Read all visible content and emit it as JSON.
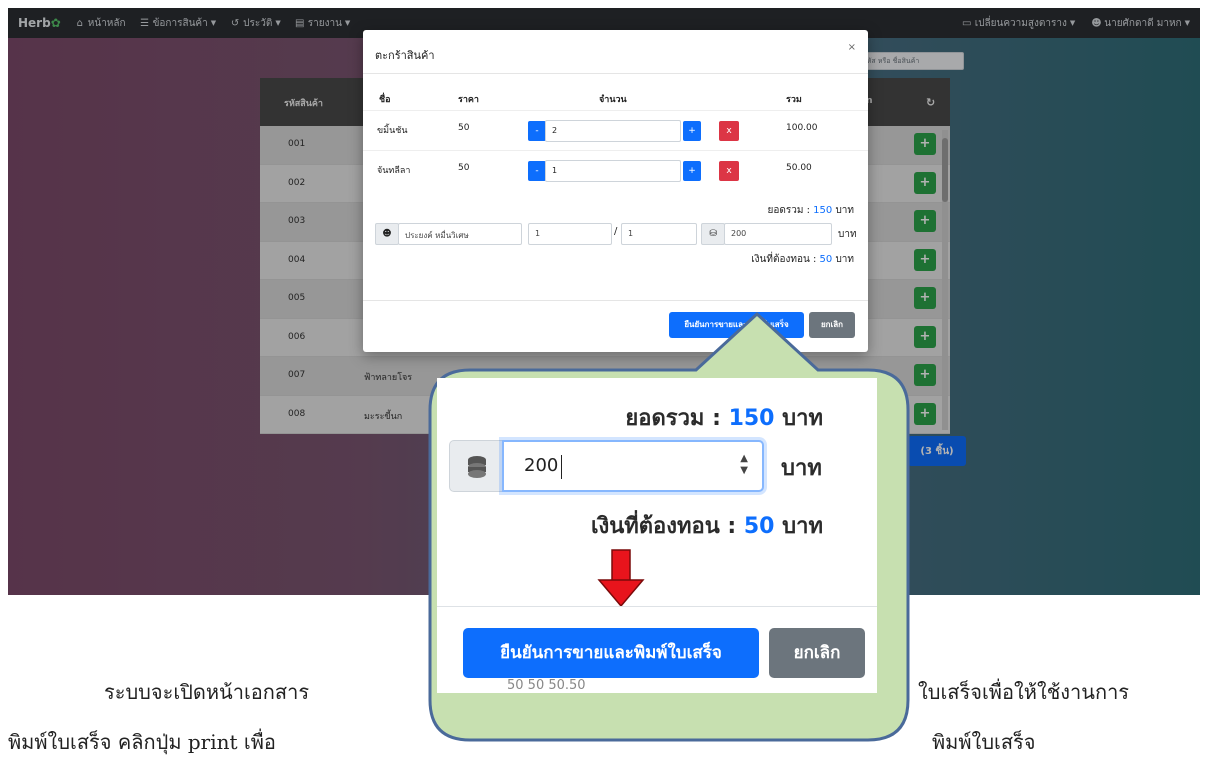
{
  "navbar": {
    "brand": "Herb",
    "items": [
      {
        "label": "หน้าหลัก",
        "icon": "home-icon"
      },
      {
        "label": "ข้อการสินค้า",
        "icon": "list-icon"
      },
      {
        "label": "ประวัติ",
        "icon": "history-icon"
      },
      {
        "label": "รายงาน",
        "icon": "report-icon"
      }
    ],
    "right": [
      {
        "label": "เปลี่ยนความสูงตาราง",
        "icon": "table-icon"
      },
      {
        "label": "นายศักดาดี มาหก",
        "icon": "user-icon"
      }
    ]
  },
  "search": {
    "placeholder": "รหัส หรือ ชื่อสินค้า"
  },
  "table": {
    "columns": [
      "รหัสสินค้า",
      "on"
    ],
    "rows": [
      {
        "code": "001",
        "name": ""
      },
      {
        "code": "002",
        "name": ""
      },
      {
        "code": "003",
        "name": ""
      },
      {
        "code": "004",
        "name": ""
      },
      {
        "code": "005",
        "name": ""
      },
      {
        "code": "006",
        "name": ""
      },
      {
        "code": "007",
        "name": "ฟ้าทลายโจร"
      },
      {
        "code": "008",
        "name": "มะระขี้นก"
      }
    ],
    "count_button": "(3 ชิ้น)"
  },
  "modal": {
    "title": "ตะกร้าสินค้า",
    "close": "×",
    "headers": {
      "name": "ชื่อ",
      "price": "ราคา",
      "qty": "จำนวน",
      "total": "รวม"
    },
    "items": [
      {
        "name": "ขมิ้นชัน",
        "price": "50",
        "qty": "2",
        "total": "100.00"
      },
      {
        "name": "จันทลีลา",
        "price": "50",
        "qty": "1",
        "total": "50.00"
      }
    ],
    "minus": "-",
    "plus": "+",
    "delete": "x",
    "sum_label": "ยอดรวม :",
    "sum_value": "150",
    "baht": "บาท",
    "customer": "ประยงค์ หมื่นวิเศษ",
    "page_current": "1",
    "page_sep": "/",
    "page_total": "1",
    "paid": "200",
    "change_label": "เงินที่ต้องทอน :",
    "change_value": "50",
    "confirm": "ยืนยันการขายและพิมพ์ใบเสร็จ",
    "cancel": "ยกเลิก"
  },
  "zoom": {
    "sum_label": "ยอดรวม :",
    "sum_value": "150",
    "baht": "บาท",
    "paid": "200",
    "change_label": "เงินที่ต้องทอน :",
    "change_value": "50",
    "confirm": "ยืนยันการขายและพิมพ์ใบเสร็จ",
    "cancel": "ยกเลิก",
    "faded_row": "50   50   50.50"
  },
  "document": {
    "line1_left": "ระบบจะเปิดหน้าเอกสาร",
    "line1_right": "ใบเสร็จเพื่อให้ใช้งานการ",
    "line2_left": "พิมพ์ใบเสร็จ คลิกปุ่ม print เพื่อ",
    "line2_right": "พิมพ์ใบเสร็จ"
  },
  "colors": {
    "primary": "#0d6efd",
    "danger": "#dc3545",
    "success": "#2ca24a",
    "secondary": "#6c757d",
    "callout_fill": "#c7e0b0",
    "callout_stroke": "#4a6a9a",
    "arrow": "#e8141c"
  }
}
